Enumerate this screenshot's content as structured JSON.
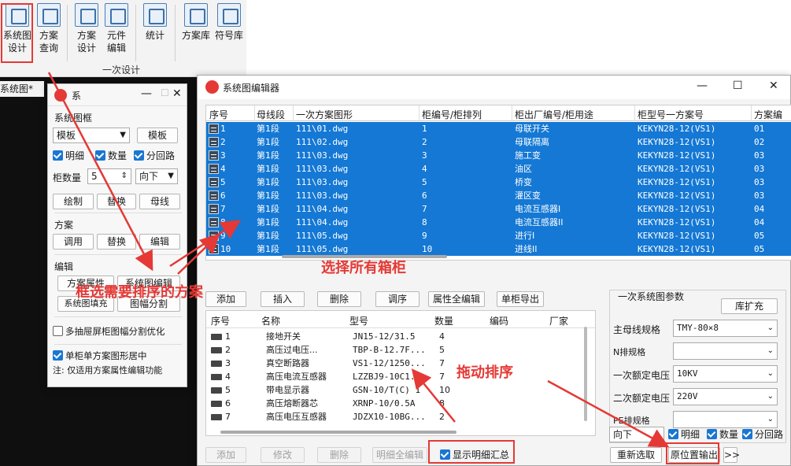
{
  "ribbon": {
    "buttons": [
      "系统图\n设计",
      "方案\n查询",
      "方案\n设计",
      "元件\n编辑",
      "统计",
      "方案库",
      "符号库"
    ],
    "group_label": "一次设计"
  },
  "doc_tab": "系统图*",
  "panel": {
    "title": "系",
    "sec_frame": "系统图框",
    "template_select": "模板",
    "template_btn": "模板",
    "chk_detail": "明细",
    "chk_qty": "数量",
    "chk_branch": "分回路",
    "cab_count_label": "柜数量",
    "cab_count_value": "5",
    "direction": "向下",
    "btn_draw": "绘制",
    "btn_replace1": "替换",
    "btn_bus": "母线",
    "sec_scheme": "方案",
    "btn_call": "调用",
    "btn_replace2": "替换",
    "btn_edit": "编辑",
    "sec_edit": "编辑",
    "btn_scheme_attr": "方案属性",
    "btn_sys_edit": "系统图编辑",
    "btn_sys_fill": "系统图填充",
    "btn_frame_split": "图幅分割",
    "chk_multi": "多抽屉屏柜图幅分割优化",
    "chk_single": "单柜单方案图形居中",
    "note": "注: 仅适用方案属性编辑功能"
  },
  "editor": {
    "title": "系统图编辑器",
    "headers": [
      "序号",
      "母线段",
      "一次方案图形",
      "柜编号/柜排列",
      "柜出厂编号/柜用途",
      "柜型号一方案号",
      "方案编"
    ],
    "rows": [
      {
        "no": "1",
        "bus": "第1段",
        "dwg": "111\\01.dwg",
        "cab": "1",
        "use": "母联开关",
        "model": "KEKYN28-12(VS1)",
        "scheme": "01"
      },
      {
        "no": "2",
        "bus": "第1段",
        "dwg": "111\\02.dwg",
        "cab": "2",
        "use": "母联隔离",
        "model": "KEKYN28-12(VS1)",
        "scheme": "02"
      },
      {
        "no": "3",
        "bus": "第1段",
        "dwg": "111\\03.dwg",
        "cab": "3",
        "use": "施工变",
        "model": "KEKYN28-12(VS1)",
        "scheme": "03"
      },
      {
        "no": "4",
        "bus": "第1段",
        "dwg": "111\\03.dwg",
        "cab": "4",
        "use": "油区",
        "model": "KEKYN28-12(VS1)",
        "scheme": "03"
      },
      {
        "no": "5",
        "bus": "第1段",
        "dwg": "111\\03.dwg",
        "cab": "5",
        "use": "桥变",
        "model": "KEKYN28-12(VS1)",
        "scheme": "03"
      },
      {
        "no": "6",
        "bus": "第1段",
        "dwg": "111\\03.dwg",
        "cab": "6",
        "use": "灌区变",
        "model": "KEKYN28-12(VS1)",
        "scheme": "03"
      },
      {
        "no": "7",
        "bus": "第1段",
        "dwg": "111\\04.dwg",
        "cab": "7",
        "use": "电流互感器I",
        "model": "KEKYN28-12(VS1)",
        "scheme": "04"
      },
      {
        "no": "8",
        "bus": "第1段",
        "dwg": "111\\04.dwg",
        "cab": "8",
        "use": "电流互感器II",
        "model": "KEKYN28-12(VS1)",
        "scheme": "04"
      },
      {
        "no": "9",
        "bus": "第1段",
        "dwg": "111\\05.dwg",
        "cab": "9",
        "use": "进行I",
        "model": "KEKYN28-12(VS1)",
        "scheme": "05"
      },
      {
        "no": "10",
        "bus": "第1段",
        "dwg": "111\\05.dwg",
        "cab": "10",
        "use": "进线II",
        "model": "KEKYN28-12(VS1)",
        "scheme": "05"
      }
    ],
    "actions": [
      "添加",
      "插入",
      "删除",
      "调序",
      "属性全编辑",
      "单柜导出"
    ],
    "detail_headers": [
      "序号",
      "名称",
      "型号",
      "数量",
      "编码",
      "厂家"
    ],
    "details": [
      {
        "no": "1",
        "name": "接地开关",
        "model": "JN15-12/31.5",
        "qty": "4"
      },
      {
        "no": "2",
        "name": "高压过电压...",
        "model": "TBP-B-12.7F...",
        "qty": "5"
      },
      {
        "no": "3",
        "name": "真空断路器",
        "model": "VS1-12/1250...",
        "qty": "7"
      },
      {
        "no": "4",
        "name": "高压电流互感器",
        "model": "LZZBJ9-10C1...",
        "qty": "7"
      },
      {
        "no": "5",
        "name": "带电显示器",
        "model": "GSN-10/T(C) 1",
        "qty": "10"
      },
      {
        "no": "6",
        "name": "高压熔断器芯",
        "model": "XRNP-10/0.5A",
        "qty": "8"
      },
      {
        "no": "7",
        "name": "高压电压互感器",
        "model": "JDZX10-10BG...",
        "qty": "2"
      }
    ],
    "bottom_actions": [
      "添加",
      "修改",
      "删除",
      "明细全编辑"
    ],
    "chk_summary": "显示明细汇总",
    "params_title": "一次系统图参数",
    "btn_expand": "库扩充",
    "param_labels": [
      "主母线规格",
      "N排规格",
      "一次额定电压",
      "二次额定电压",
      "PE排规格"
    ],
    "param_values": [
      "TMY-80×8",
      "",
      "10KV",
      "220V",
      ""
    ],
    "direction": "向下",
    "chk_detail": "明细",
    "chk_qty": "数量",
    "chk_branch": "分回路",
    "btn_reselect": "重新选取",
    "btn_output": "原位置输出",
    "btn_more": ">>"
  },
  "annotations": {
    "select_all": "选择所有箱柜",
    "drag_sort": "拖动排序",
    "frame_select": "框选需要排序的方案"
  },
  "colors": {
    "selection": "#1478d4",
    "annotation": "#e53935"
  }
}
